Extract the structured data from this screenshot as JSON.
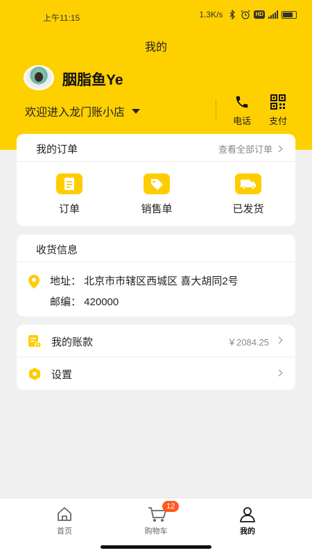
{
  "status_bar": {
    "time": "上午11:15",
    "speed": "1.3K/s",
    "icons": [
      "bluetooth-icon",
      "alarm-icon",
      "hd-icon",
      "5g-signal-icon",
      "battery-icon"
    ],
    "hd": "HD"
  },
  "header": {
    "title": "我的",
    "username": "胭脂鱼Ye",
    "welcome": "欢迎进入龙门账小店",
    "phone_label": "电话",
    "pay_label": "支付",
    "background_color": "#ffd000"
  },
  "orders": {
    "title": "我的订单",
    "view_all": "查看全部订单",
    "items": [
      {
        "label": "订单",
        "icon": "order-icon"
      },
      {
        "label": "销售单",
        "icon": "tag-icon"
      },
      {
        "label": "已发货",
        "icon": "truck-icon"
      }
    ]
  },
  "shipping": {
    "title": "收货信息",
    "address": "地址： 北京市市辖区西城区 喜大胡同2号",
    "postcode": "邮编： 420000"
  },
  "menu": {
    "account_label": "我的账款",
    "account_value": "￥2084.25",
    "settings_label": "设置"
  },
  "tabbar": {
    "home": "首页",
    "cart": "购物车",
    "cart_count": "12",
    "mine": "我的"
  },
  "colors": {
    "accent": "#ffcc00",
    "badge": "#ff5a1f"
  }
}
